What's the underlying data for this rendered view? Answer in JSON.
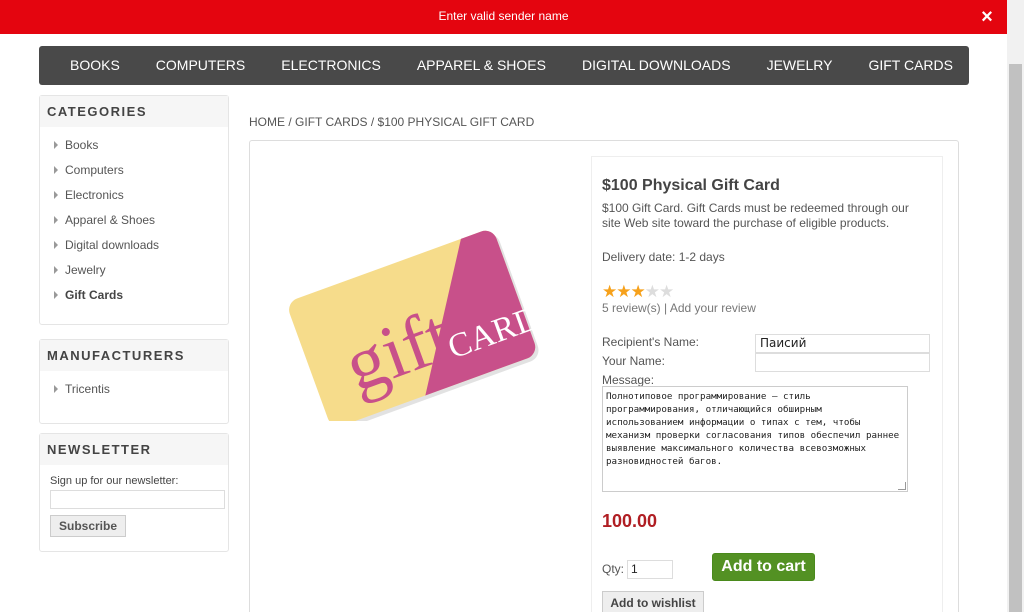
{
  "notification": {
    "text": "Enter valid sender name",
    "close_symbol": "×"
  },
  "top_menu": [
    "BOOKS",
    "COMPUTERS",
    "ELECTRONICS",
    "APPAREL & SHOES",
    "DIGITAL DOWNLOADS",
    "JEWELRY",
    "GIFT CARDS"
  ],
  "categories": {
    "title": "CATEGORIES",
    "items": [
      {
        "label": "Books"
      },
      {
        "label": "Computers"
      },
      {
        "label": "Electronics"
      },
      {
        "label": "Apparel & Shoes"
      },
      {
        "label": "Digital downloads"
      },
      {
        "label": "Jewelry"
      },
      {
        "label": "Gift Cards"
      }
    ],
    "active_index": 6
  },
  "manufacturers": {
    "title": "MANUFACTURERS",
    "items": [
      {
        "label": "Tricentis"
      }
    ]
  },
  "newsletter": {
    "title": "NEWSLETTER",
    "label": "Sign up for our newsletter:",
    "input_value": "",
    "button": "Subscribe"
  },
  "breadcrumb": {
    "home": "HOME",
    "sep": "/",
    "category": "GIFT CARDS",
    "current": "$100 PHYSICAL GIFT CARD"
  },
  "product": {
    "title": "$100 Physical Gift Card",
    "description": "$100 Gift Card. Gift Cards must be redeemed through our site Web site toward the purchase of eligible products.",
    "delivery": "Delivery date: 1-2 days",
    "rating": 3,
    "rating_max": 5,
    "reviews_text": "5 review(s)",
    "reviews_sep": "|",
    "add_review": "Add your review",
    "recipient_label": "Recipient's Name:",
    "recipient_value": "Паисий",
    "your_name_label": "Your Name:",
    "your_name_value": "",
    "message_label": "Message:",
    "message_value": "Полнотиповое программирование — стиль программирования, отличающийся обширным использованием информации о типах с тем, чтобы механизм проверки согласования типов обеспечил раннее выявление максимального количества всевозможных разновидностей багов.",
    "price": "100.00",
    "qty_label": "Qty:",
    "qty_value": "1",
    "add_to_cart": "Add to cart",
    "add_to_wishlist": "Add to wishlist",
    "image": {
      "word1": "gift",
      "word2": "CARD",
      "colors": {
        "left": "#f6dc8b",
        "right": "#c8508a",
        "text_left": "#c8508a",
        "text_right": "#ffffff"
      }
    }
  },
  "colors": {
    "notify_bg": "#e4050f",
    "menu_bg": "#494949",
    "price": "#b01e23",
    "cart_btn": "#539123",
    "star": "#f6a11b"
  }
}
